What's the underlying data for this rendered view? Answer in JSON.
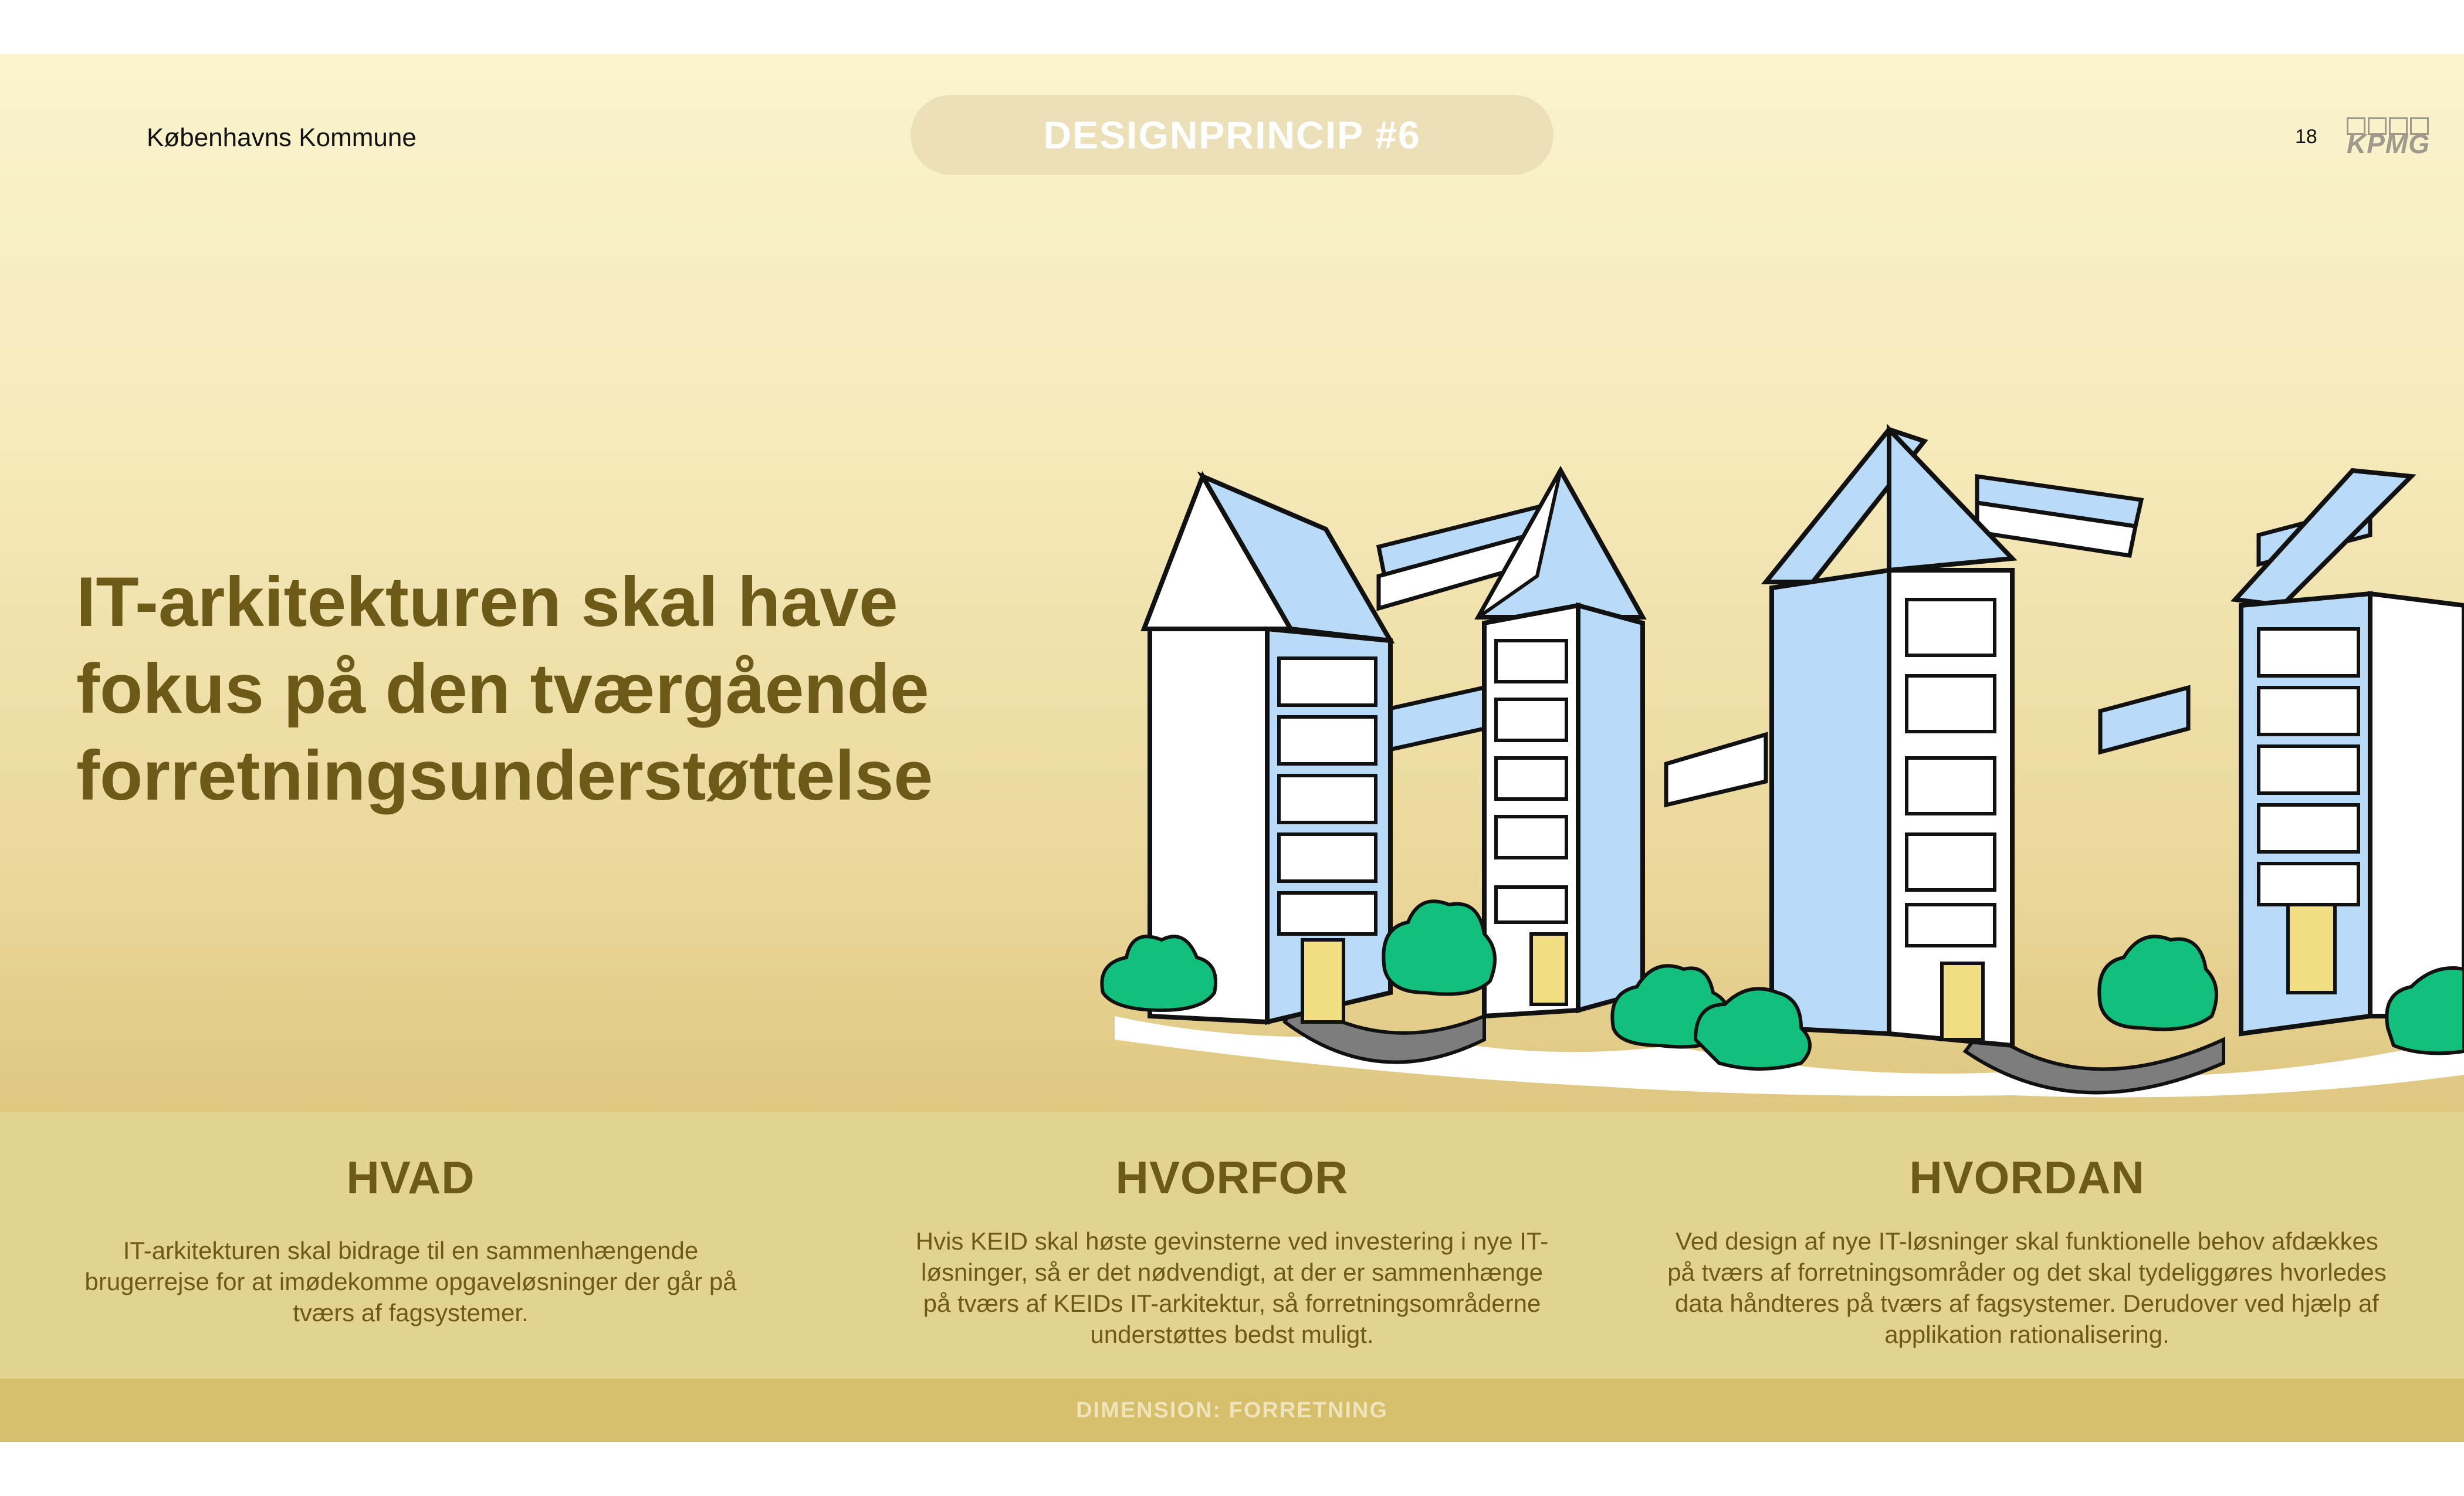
{
  "header": {
    "organization": "Københavns Kommune",
    "principle_label": "DESIGNPRINCIP #6",
    "page_number": "18",
    "logo_text": "KPMG"
  },
  "headline": {
    "line1": "IT-arkitekturen skal have",
    "line2": "fokus på den tværgående",
    "line3": "forretningsunderstøttelse"
  },
  "illustration": {
    "icon": "office-buildings-illustration"
  },
  "columns": [
    {
      "title": "HVAD",
      "body": "IT-arkitekturen skal bidrage til en sammenhængende brugerrejse for at imødekomme opgaveløsninger der går på tværs af fagsystemer."
    },
    {
      "title": "HVORFOR",
      "body": "Hvis KEID skal høste gevinsterne ved investering i nye IT-løsninger, så er det nødvendigt, at der er sammenhænge på tværs af KEIDs IT-arkitektur, så forretningsområderne understøttes bedst muligt."
    },
    {
      "title": "HVORDAN",
      "body": "Ved design af nye IT-løsninger skal funktionelle behov afdækkes på tværs af forretningsområder og det skal tydeliggøres hvorledes data håndteres på tværs af fagsystemer. Derudover ved hjælp af applikation rationalisering."
    }
  ],
  "footer": {
    "dimension": "DIMENSION: FORRETNING"
  },
  "colors": {
    "title_text": "#6d5a18",
    "band": "#e3d391",
    "footer_band": "#d6bf6a",
    "building_blue": "#b9dbf7",
    "shrub_green": "#12bf7d",
    "door_yellow": "#f2df83"
  }
}
